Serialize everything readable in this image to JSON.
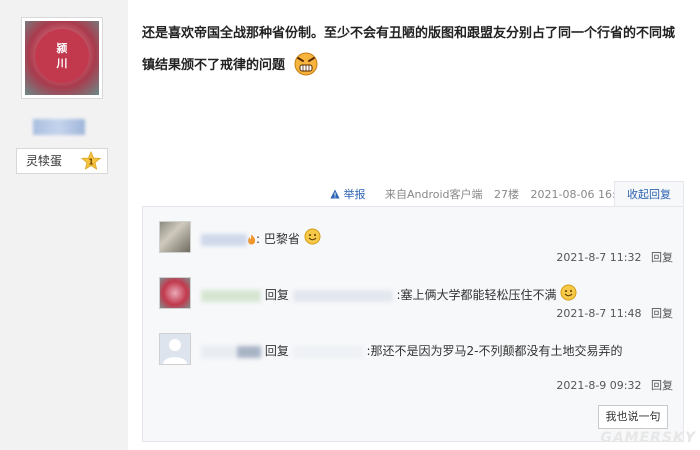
{
  "user": {
    "avatar_text": [
      "颍",
      "川"
    ],
    "rank_label": "灵犊蛋",
    "rank_level": "1"
  },
  "post": {
    "text": "还是喜欢帝国全战那种省份制。至少不会有丑陋的版图和跟盟友分别占了同一个行省的不同城镇结果颁不了戒律的问题"
  },
  "meta": {
    "report": "举报",
    "source": "来自Android客户端",
    "floor": "27楼",
    "time": "2021-08-06 16:10",
    "collapse": "收起回复"
  },
  "comments": [
    {
      "text": ": 巴黎省",
      "time": "2021-8-7 11:32",
      "reply": "回复"
    },
    {
      "prefix": "回复",
      "text": ":塞上俩大学都能轻松压住不满",
      "time": "2021-8-7 11:48",
      "reply": "回复"
    },
    {
      "prefix": "回复",
      "text": ":那还不是因为罗马2-不列颠都没有土地交易弄的",
      "time": "2021-8-9 09:32",
      "reply": "回复"
    }
  ],
  "say_button": "我也说一句",
  "watermark": "GAMERSKY",
  "colors": {
    "link": "#2d64b3",
    "comment_bg": "#f7f8fa"
  }
}
